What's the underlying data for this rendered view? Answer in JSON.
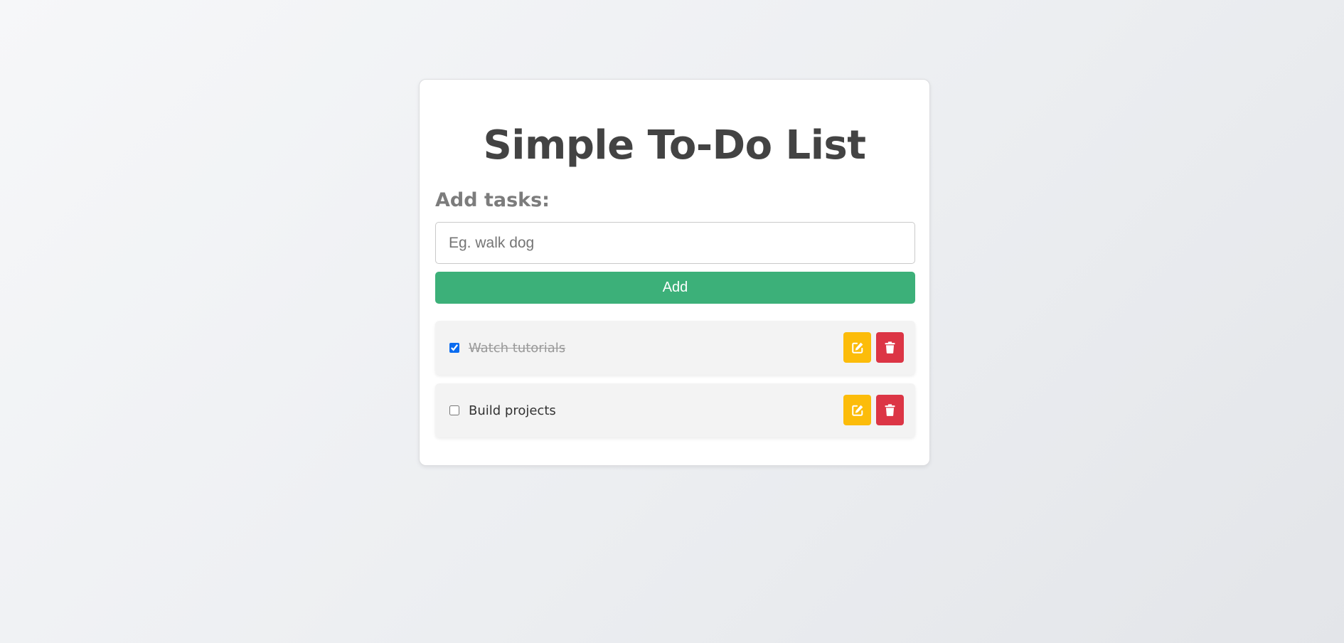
{
  "app": {
    "title": "Simple To-Do List"
  },
  "form": {
    "label": "Add tasks:",
    "input_value": "",
    "input_placeholder": "Eg. walk dog",
    "add_button_label": "Add"
  },
  "tasks": [
    {
      "text": "Watch tutorials",
      "completed": true
    },
    {
      "text": "Build projects",
      "completed": false
    }
  ],
  "icons": {
    "edit": "edit-icon",
    "delete": "trash-icon"
  },
  "colors": {
    "add_button": "#3cb079",
    "edit_button": "#fcbc0a",
    "delete_button": "#dc3545",
    "title": "#434343",
    "label": "#7c7c7c"
  }
}
